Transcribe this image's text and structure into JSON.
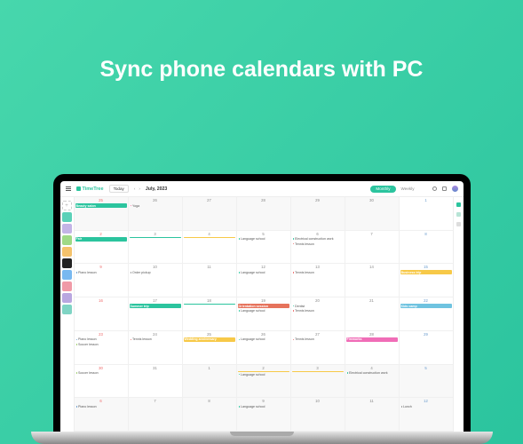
{
  "hero": {
    "title": "Sync phone calendars with PC"
  },
  "brand": "TimeTree",
  "toolbar": {
    "today": "Today",
    "month_label": "July, 2023",
    "view_monthly": "Monthly",
    "view_weekly": "Weekly"
  },
  "sidebar_tiles": [
    {
      "bg": "#5bd1b8"
    },
    {
      "bg": "#c3b4e6"
    },
    {
      "bg": "#9fd986"
    },
    {
      "bg": "#f4c26b"
    },
    {
      "bg": "#222"
    },
    {
      "bg": "#78b8f0"
    },
    {
      "bg": "#f09aa7"
    },
    {
      "bg": "#b9a7e0"
    },
    {
      "bg": "#7fd4c4"
    }
  ],
  "rightbar": [
    {
      "bg": "#2bc49e"
    },
    {
      "bg": "#b8e4d6"
    },
    {
      "bg": "#ddd"
    }
  ],
  "weeks": [
    {
      "days": [
        {
          "num": "25",
          "dim": true,
          "sun": true,
          "events": [
            {
              "t": "block",
              "c": "#2bc49e",
              "label": "Beauty salon"
            }
          ]
        },
        {
          "num": "26",
          "dim": true,
          "events": [
            {
              "t": "line",
              "c": "#f7a",
              "label": "Yoga"
            }
          ]
        },
        {
          "num": "27",
          "dim": true,
          "events": []
        },
        {
          "num": "28",
          "dim": true,
          "events": []
        },
        {
          "num": "29",
          "dim": true,
          "events": []
        },
        {
          "num": "30",
          "dim": true,
          "events": []
        },
        {
          "num": "1",
          "sat": true,
          "events": []
        }
      ]
    },
    {
      "days": [
        {
          "num": "2",
          "sun": true,
          "events": [
            {
              "t": "block",
              "c": "#2bc49e",
              "label": "Fair"
            }
          ]
        },
        {
          "num": "3",
          "events": [
            {
              "t": "block",
              "c": "#2bc49e",
              "label": ""
            }
          ]
        },
        {
          "num": "4",
          "events": [
            {
              "t": "block",
              "c": "#f7c948",
              "label": ""
            }
          ]
        },
        {
          "num": "5",
          "events": [
            {
              "t": "line",
              "c": "#2bc49e",
              "label": "Language school"
            }
          ]
        },
        {
          "num": "6",
          "events": [
            {
              "t": "line",
              "c": "#2bc49e",
              "label": "Electrical construction work"
            },
            {
              "t": "line",
              "c": "#e66",
              "label": "Tennis lesson"
            }
          ]
        },
        {
          "num": "7",
          "events": []
        },
        {
          "num": "8",
          "sat": true,
          "events": []
        }
      ]
    },
    {
      "days": [
        {
          "num": "9",
          "sun": true,
          "events": [
            {
              "t": "line",
              "c": "#69c",
              "label": "Piano lesson"
            }
          ]
        },
        {
          "num": "10",
          "events": [
            {
              "t": "line",
              "c": "#999",
              "label": "Order pickup"
            }
          ]
        },
        {
          "num": "11",
          "events": []
        },
        {
          "num": "12",
          "events": [
            {
              "t": "line",
              "c": "#2bc49e",
              "label": "Language school"
            }
          ]
        },
        {
          "num": "13",
          "events": [
            {
              "t": "line",
              "c": "#e66",
              "label": "Tennis lesson"
            }
          ]
        },
        {
          "num": "14",
          "events": []
        },
        {
          "num": "15",
          "sat": true,
          "events": [
            {
              "t": "block",
              "c": "#f7c948",
              "label": "Business trip"
            }
          ]
        }
      ]
    },
    {
      "days": [
        {
          "num": "16",
          "sun": true,
          "events": []
        },
        {
          "num": "17",
          "events": [
            {
              "t": "block",
              "c": "#2bc49e",
              "label": "Summer trip"
            }
          ]
        },
        {
          "num": "18",
          "events": [
            {
              "t": "block",
              "c": "#2bc49e",
              "label": ""
            }
          ]
        },
        {
          "num": "19",
          "events": [
            {
              "t": "block",
              "c": "#e6735c",
              "label": "Orientation session"
            },
            {
              "t": "line",
              "c": "#2bc49e",
              "label": "Language school"
            }
          ]
        },
        {
          "num": "20",
          "events": [
            {
              "t": "line",
              "c": "#2bc49e",
              "label": "Dentist"
            },
            {
              "t": "line",
              "c": "#e66",
              "label": "Tennis lesson"
            }
          ]
        },
        {
          "num": "21",
          "events": []
        },
        {
          "num": "22",
          "sat": true,
          "events": [
            {
              "t": "block",
              "c": "#6fc3e0",
              "label": "Kids camp"
            }
          ]
        }
      ]
    },
    {
      "days": [
        {
          "num": "23",
          "sun": true,
          "events": [
            {
              "t": "line",
              "c": "#69c",
              "label": "Piano lesson"
            },
            {
              "t": "line",
              "c": "#9c6",
              "label": "Soccer lesson"
            }
          ]
        },
        {
          "num": "24",
          "events": [
            {
              "t": "line",
              "c": "#e66",
              "label": "Tennis lesson"
            }
          ]
        },
        {
          "num": "25",
          "events": [
            {
              "t": "block",
              "c": "#f7c948",
              "label": "Wedding anniversary"
            }
          ]
        },
        {
          "num": "26",
          "events": [
            {
              "t": "line",
              "c": "#2bc49e",
              "label": "Language school"
            }
          ]
        },
        {
          "num": "27",
          "events": [
            {
              "t": "line",
              "c": "#e66",
              "label": "Tennis lesson"
            }
          ]
        },
        {
          "num": "28",
          "events": [
            {
              "t": "block",
              "c": "#f06db7",
              "label": "Fireworks"
            }
          ]
        },
        {
          "num": "29",
          "sat": true,
          "events": []
        }
      ]
    },
    {
      "days": [
        {
          "num": "30",
          "sun": true,
          "events": [
            {
              "t": "line",
              "c": "#9c6",
              "label": "Soccer lesson"
            }
          ]
        },
        {
          "num": "31",
          "events": []
        },
        {
          "num": "1",
          "dim": true,
          "events": []
        },
        {
          "num": "2",
          "dim": true,
          "events": [
            {
              "t": "block",
              "c": "#f7c948",
              "label": ""
            },
            {
              "t": "line",
              "c": "#2bc49e",
              "label": "Language school"
            }
          ]
        },
        {
          "num": "3",
          "dim": true,
          "events": [
            {
              "t": "block",
              "c": "#f7c948",
              "label": ""
            }
          ]
        },
        {
          "num": "4",
          "dim": true,
          "events": [
            {
              "t": "line",
              "c": "#2bc49e",
              "label": "Electrical construction work"
            }
          ]
        },
        {
          "num": "5",
          "dim": true,
          "sat": true,
          "events": []
        }
      ]
    },
    {
      "days": [
        {
          "num": "6",
          "dim": true,
          "sun": true,
          "events": [
            {
              "t": "line",
              "c": "#69c",
              "label": "Piano lesson"
            }
          ]
        },
        {
          "num": "7",
          "dim": true,
          "events": []
        },
        {
          "num": "8",
          "dim": true,
          "events": []
        },
        {
          "num": "9",
          "dim": true,
          "events": [
            {
              "t": "line",
              "c": "#2bc49e",
              "label": "Language school"
            }
          ]
        },
        {
          "num": "10",
          "dim": true,
          "events": []
        },
        {
          "num": "11",
          "dim": true,
          "events": []
        },
        {
          "num": "12",
          "dim": true,
          "sat": true,
          "events": [
            {
              "t": "line",
              "c": "#999",
              "label": "Lunch"
            }
          ]
        }
      ]
    }
  ]
}
